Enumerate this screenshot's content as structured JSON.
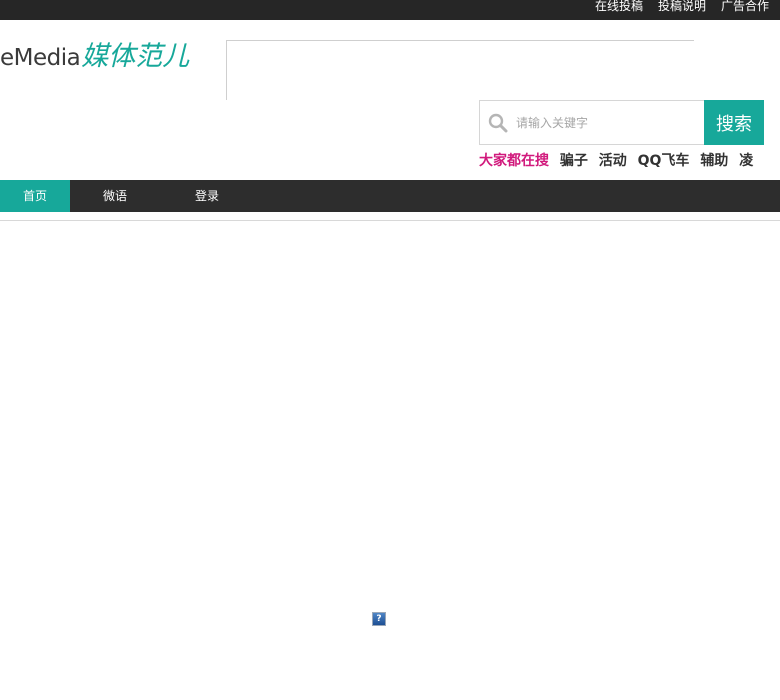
{
  "top_links": [
    "在线投稿",
    "投稿说明",
    "广告合作"
  ],
  "logo": {
    "text_en": "eMedia",
    "text_cn": "媒体范儿",
    "accent_color": "#17a89a"
  },
  "search": {
    "placeholder": "请输入关键字",
    "button_label": "搜索",
    "icon": "search-icon"
  },
  "hotwords": {
    "label": "大家都在搜",
    "label_color": "#d1197c",
    "items": [
      "骗子",
      "活动",
      "QQ飞车",
      "辅助",
      "凌"
    ]
  },
  "nav": {
    "items": [
      "首页",
      "微语",
      "登录"
    ],
    "active_index": 0
  },
  "broken_image": {
    "glyph": "?"
  }
}
